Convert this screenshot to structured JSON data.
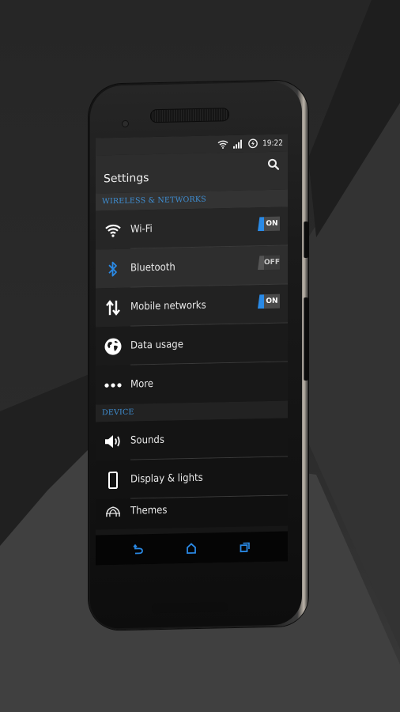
{
  "status_bar": {
    "time": "19:22",
    "icons": [
      "wifi-icon",
      "signal-icon",
      "battery-charging-icon"
    ]
  },
  "action_bar": {
    "title": "Settings",
    "search_icon": "search-icon"
  },
  "sections": [
    {
      "header": "WIRELESS & NETWORKS",
      "items": [
        {
          "label": "Wi-Fi",
          "icon": "wifi-icon",
          "toggle": "ON"
        },
        {
          "label": "Bluetooth",
          "icon": "bluetooth-icon",
          "toggle": "OFF"
        },
        {
          "label": "Mobile networks",
          "icon": "data-arrows-icon",
          "toggle": "ON"
        },
        {
          "label": "Data usage",
          "icon": "globe-icon"
        },
        {
          "label": "More",
          "icon": "more-dots-icon"
        }
      ]
    },
    {
      "header": "DEVICE",
      "items": [
        {
          "label": "Sounds",
          "icon": "speaker-icon"
        },
        {
          "label": "Display & lights",
          "icon": "phone-display-icon"
        },
        {
          "label": "Themes",
          "icon": "themes-icon"
        }
      ]
    }
  ],
  "nav_bar": {
    "buttons": [
      "back-icon",
      "home-icon",
      "recents-icon"
    ]
  },
  "colors": {
    "accent": "#2a8ae6",
    "section_header": "#3f8fd4",
    "toggle_track": "#4a4a4a"
  }
}
